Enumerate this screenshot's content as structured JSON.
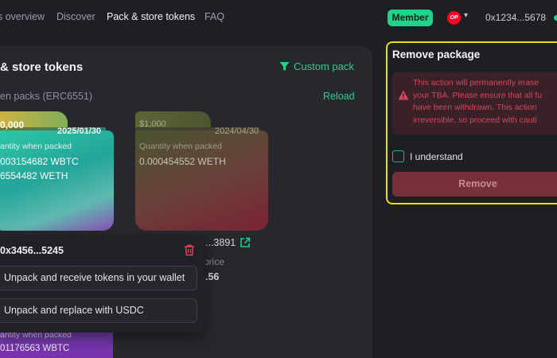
{
  "nav": {
    "items": [
      "s overview",
      "Discover",
      "Pack & store tokens",
      "FAQ"
    ],
    "active_index": 2,
    "member_badge": "Member",
    "network_logo": "OP",
    "wallet_address": "0x1234...5678"
  },
  "main": {
    "title": "& store tokens",
    "custom_pack_label": "Custom pack",
    "section_label": "en packs (ERC6551)",
    "reload_label": "Reload",
    "cards": [
      {
        "value": "0,000",
        "date": "2025/01/30",
        "quantity_label": "antity when packed",
        "quantities": [
          "003154682 WBTC",
          "6554482 WETH"
        ]
      },
      {
        "value": "$1,000",
        "date": "2024/04/30",
        "quantity_label": "Quantity when packed",
        "quantities": [
          "0.000454552 WETH"
        ],
        "address": "...3891",
        "price_label": "price",
        "price": ".56"
      },
      {
        "quantity_label": "antity when packed",
        "quantities": [
          "01176563 WBTC"
        ]
      }
    ]
  },
  "popup": {
    "address": "0x3456...5245",
    "options": [
      "Unpack and receive tokens in your wallet",
      "Unpack and replace with USDC"
    ]
  },
  "remove_package": {
    "title": "Remove package",
    "warning_lines": [
      "This action will permanently erase",
      "your TBA. Please ensure that all fu",
      "have been withdrawn. This action",
      "irreversible, so proceed with cauti"
    ],
    "checkbox_label": "I understand",
    "button_label": "Remove"
  },
  "colors": {
    "accent": "#1fd38b",
    "highlight_border": "#e9df17",
    "danger": "#d8455d"
  }
}
